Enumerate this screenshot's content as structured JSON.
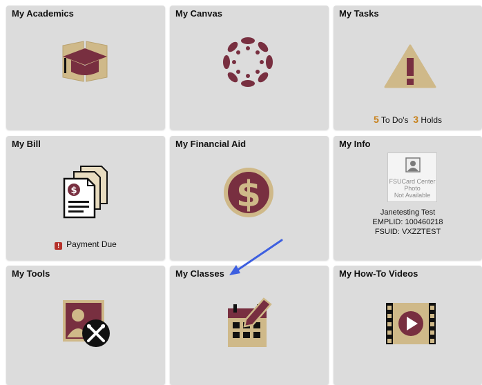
{
  "tiles": {
    "academics": {
      "title": "My Academics",
      "icon": "graduation-cap-book-icon"
    },
    "canvas": {
      "title": "My Canvas",
      "icon": "canvas-logo-icon"
    },
    "tasks": {
      "title": "My Tasks",
      "icon": "warning-triangle-icon",
      "todo_count": "5",
      "todo_label": "To Do's",
      "holds_count": "3",
      "holds_label": "Holds"
    },
    "bill": {
      "title": "My Bill",
      "icon": "bill-document-icon",
      "alert_icon": "!",
      "status": "Payment Due"
    },
    "financial_aid": {
      "title": "My Financial Aid",
      "icon": "dollar-coin-icon"
    },
    "info": {
      "title": "My Info",
      "photo_text": [
        "FSUCard Center",
        "Photo",
        "Not Available"
      ],
      "name": "Janetesting Test",
      "emplid": "EMPLID: 100460218",
      "fsuid": "FSUID: VXZZTEST"
    },
    "tools": {
      "title": "My Tools",
      "icon": "user-tools-icon"
    },
    "classes": {
      "title": "My Classes",
      "icon": "calendar-pencil-icon"
    },
    "videos": {
      "title": "My How-To Videos",
      "icon": "film-play-icon"
    }
  },
  "colors": {
    "garnet": "#782f40",
    "gold": "#cfb989",
    "tile_bg": "#dcdcdc",
    "arrow": "#3d5fe0",
    "count_orange": "#c8811a"
  }
}
